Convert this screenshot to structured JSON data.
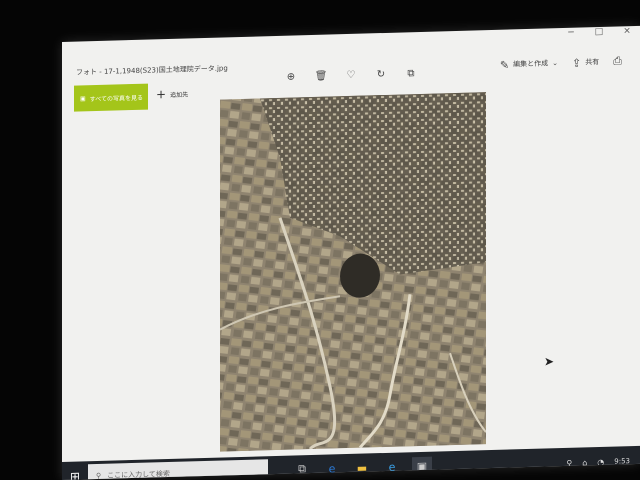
{
  "window": {
    "title": "フォト - 17-1,1948(S23)国土地理院データ.jpg",
    "controls": {
      "minimize": "−",
      "maximize": "□",
      "close": "×"
    }
  },
  "toolbar": {
    "icons": [
      "zoom-in-icon",
      "delete-icon",
      "favorite-icon",
      "rotate-icon",
      "crop-icon"
    ],
    "icon_glyphs": [
      "⊕",
      "🗑",
      "♡",
      "↻",
      "⧉"
    ],
    "edit_label": "編集と作成",
    "share_label": "共有",
    "print_icon": "⎙"
  },
  "left_actions": {
    "view_all_label": "すべての写真を見る",
    "add_to_label": "追加先"
  },
  "taskbar": {
    "start_icon": "⊞",
    "search_placeholder": "ここに入力して検索",
    "apps": [
      "task-view",
      "edge",
      "explorer",
      "ie",
      "photos"
    ],
    "app_glyphs": [
      "⧉",
      "e",
      "▬",
      "e",
      "▣"
    ],
    "tray_glyphs": [
      "⚲",
      "⌂",
      "◔"
    ],
    "clock": "9:53"
  }
}
